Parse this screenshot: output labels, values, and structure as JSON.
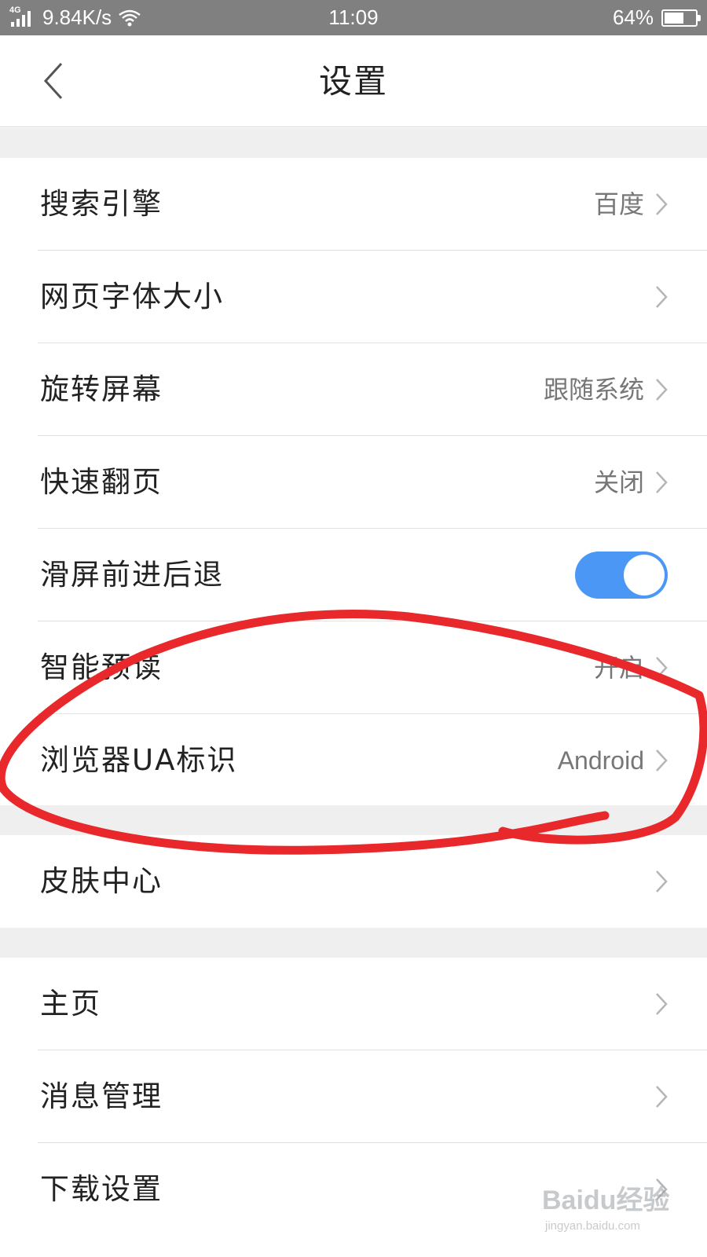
{
  "status_bar": {
    "network_type": "4G",
    "speed": "9.84K/s",
    "time": "11:09",
    "battery_percent": "64%",
    "battery_level": 0.64,
    "icons": [
      "signal-icon",
      "wifi-icon",
      "battery-icon"
    ]
  },
  "header": {
    "title": "设置",
    "back_icon": "chevron-left-icon"
  },
  "settings": [
    {
      "label": "搜索引擎",
      "value": "百度"
    },
    {
      "label": "网页字体大小",
      "value": ""
    },
    {
      "label": "旋转屏幕",
      "value": "跟随系统"
    },
    {
      "label": "快速翻页",
      "value": "关闭"
    },
    {
      "label": "滑屏前进后退",
      "toggle_on": true
    },
    {
      "label": "智能预读",
      "value": "开启"
    },
    {
      "label": "浏览器UA标识",
      "value": "Android"
    },
    {
      "label": "皮肤中心",
      "value": ""
    },
    {
      "label": "主页",
      "value": ""
    },
    {
      "label": "消息管理",
      "value": ""
    },
    {
      "label": "下载设置",
      "value": ""
    }
  ],
  "watermark": {
    "logo_text": "Baidu经验",
    "url": "jingyan.baidu.com"
  },
  "colors": {
    "status_bar_bg": "#808080",
    "section_gap_bg": "#efefef",
    "toggle_on": "#4a97f6",
    "annotation_red": "#e8282b",
    "label_text": "#222222",
    "value_text": "#777777"
  }
}
